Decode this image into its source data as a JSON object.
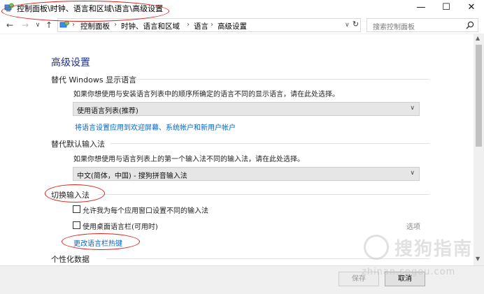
{
  "window": {
    "title": "控制面板\\时钟、语言和区域\\语言\\高级设置",
    "minimize": "—",
    "maximize": "☐",
    "close": "✕"
  },
  "nav": {
    "back": "←",
    "forward": "→",
    "recent": "∨",
    "up": "↑",
    "breadcrumbs": [
      "控制面板",
      "时钟、语言和区域",
      "语言",
      "高级设置"
    ],
    "separator": "›",
    "dropdown": "∨",
    "refresh": "↻",
    "search_placeholder": "搜索控制面板"
  },
  "page": {
    "title": "高级设置",
    "display_language": {
      "heading": "替代 Windows 显示语言",
      "description": "如果你想使用与安装语言列表中的顺序所确定的语言不同的显示语言，请在此处选择。",
      "selected": "使用语言列表(推荐)",
      "link": "将语言设置应用到欢迎屏幕、系统帐户和新用户帐户"
    },
    "default_input": {
      "heading": "替代默认输入法",
      "description": "如果你想使用与语言列表上的第一个输入法不同的输入法，请在此处选择。",
      "selected": "中文(简体，中国) - 搜狗拼音输入法"
    },
    "switch_input": {
      "heading": "切换输入法",
      "checkbox1": "允许我为每个应用窗口设置不同的输入法",
      "checkbox2": "使用桌面语言栏(可用时)",
      "options": "选项",
      "link": "更改语言栏热键"
    },
    "personalization": {
      "heading": "个性化数据"
    }
  },
  "footer": {
    "save": "保存",
    "cancel": "取消"
  },
  "watermark": {
    "text": "搜狗指南",
    "url": "zhinan.sogou.com"
  },
  "colors": {
    "title_blue": "#1e3287",
    "link_blue": "#0066cc",
    "annotation_red": "#e0201a"
  }
}
